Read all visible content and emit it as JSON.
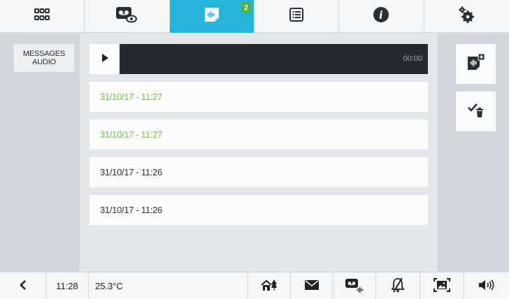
{
  "nav": {
    "tabs": [
      {
        "icon": "grid-icon",
        "active": false
      },
      {
        "icon": "video-memory-icon",
        "active": false
      },
      {
        "icon": "audio-message-icon",
        "active": true,
        "badge": "2"
      },
      {
        "icon": "list-icon",
        "active": false
      },
      {
        "icon": "info-icon",
        "active": false
      },
      {
        "icon": "settings-gears-icon",
        "active": false
      }
    ]
  },
  "sidebar": {
    "category_line1": "MESSAGES",
    "category_line2": "AUDIO"
  },
  "player": {
    "time": "00:00",
    "progress": 0
  },
  "messages": [
    {
      "datetime": "31/10/17 - 11:27",
      "unread": true
    },
    {
      "datetime": "31/10/17 - 11:27",
      "unread": true
    },
    {
      "datetime": "31/10/17 - 11:26",
      "unread": false
    },
    {
      "datetime": "31/10/17 - 11:26",
      "unread": false
    }
  ],
  "status": {
    "time": "11:28",
    "temperature": "25.3°C"
  },
  "colors": {
    "accent": "#24b5d8",
    "badge": "#55b240",
    "unread": "#7cbf4d"
  }
}
